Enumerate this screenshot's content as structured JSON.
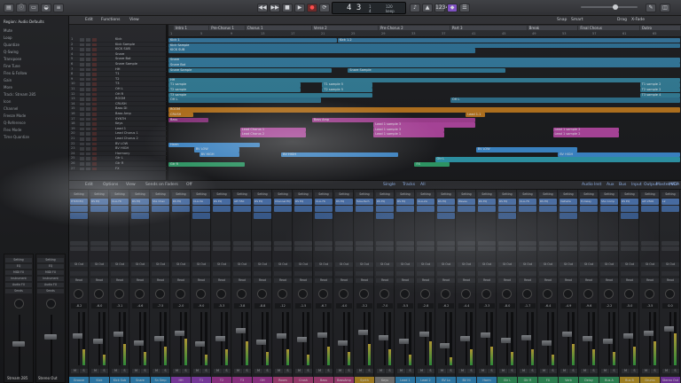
{
  "topbar": {
    "lcd_bar": "4 3",
    "lcd_beat": [
      "1",
      "4"
    ],
    "lcd_tempo": [
      "120",
      "keep"
    ],
    "buttons": [
      "stop",
      "rewind",
      "forward",
      "play",
      "record",
      "cycle"
    ]
  },
  "inspector": {
    "region_header": "Region: Audio Defaults",
    "track_header": "Track: Stream 285",
    "lines": [
      "Mute",
      "Loop",
      "Quantize",
      "Q-Swing",
      "Transpose",
      "Fine Tune",
      "Flex & Follow",
      "Gain",
      "More",
      "Track: Stream 285",
      "Icon",
      "Channel",
      "Freeze Mode",
      "Q-Reference",
      "Flex Mode",
      "Time Quantize"
    ],
    "strip_labels": [
      "Stream 285",
      "Stereo Out"
    ],
    "strip_buttons": [
      "Setting",
      "EQ",
      "MIDI FX",
      "Instrument",
      "Audio FX",
      "Sends"
    ]
  },
  "arrange_menu": [
    "Edit",
    "Functions",
    "View"
  ],
  "arrange_right": [
    "Snap",
    "Smart",
    "Drag",
    "X-Fade"
  ],
  "ruler": {
    "markers": [
      "Intro 1",
      "Pre-Chorus 1",
      "Chorus 1",
      "Verse 2",
      "Pre-Chorus 2",
      "Part 3",
      "Break",
      "Final Chorus",
      "Outro"
    ],
    "numbers": [
      "1",
      "5",
      "9",
      "13",
      "17",
      "21",
      "25",
      "29",
      "33",
      "37",
      "41",
      "45",
      "49",
      "53",
      "57",
      "61",
      "65"
    ]
  },
  "tracks": [
    {
      "n": "1",
      "name": "Kick"
    },
    {
      "n": "2",
      "name": "Kick Sample"
    },
    {
      "n": "3",
      "name": "KICK SUB"
    },
    {
      "n": "4",
      "name": "Snare"
    },
    {
      "n": "5",
      "name": "Snare Bot"
    },
    {
      "n": "6",
      "name": "Snare Sample"
    },
    {
      "n": "7",
      "name": "HH"
    },
    {
      "n": "8",
      "name": "T1"
    },
    {
      "n": "9",
      "name": "T2"
    },
    {
      "n": "10",
      "name": "T3"
    },
    {
      "n": "11",
      "name": "OH L"
    },
    {
      "n": "12",
      "name": "OH R"
    },
    {
      "n": "13",
      "name": "ROOM"
    },
    {
      "n": "14",
      "name": "CRUSH"
    },
    {
      "n": "15",
      "name": "Bass DI"
    },
    {
      "n": "16",
      "name": "Bass Amp"
    },
    {
      "n": "17",
      "name": "SYNTH"
    },
    {
      "n": "18",
      "name": "Keys"
    },
    {
      "n": "19",
      "name": "Lead 1"
    },
    {
      "n": "20",
      "name": "Lead Chorus 1"
    },
    {
      "n": "21",
      "name": "Lead Chorus 2"
    },
    {
      "n": "22",
      "name": "BV LOW"
    },
    {
      "n": "23",
      "name": "BV HIGH"
    },
    {
      "n": "24",
      "name": "Harmony"
    },
    {
      "n": "25",
      "name": "Gtr L"
    },
    {
      "n": "26",
      "name": "Gtr R"
    },
    {
      "n": "27",
      "name": "FX"
    }
  ],
  "regions": [
    {
      "row": 0,
      "s": 0.0,
      "e": 0.33,
      "c": "#2f6f96",
      "t": "Kick 1"
    },
    {
      "row": 0,
      "s": 0.33,
      "e": 1.0,
      "c": "#2f6f96",
      "t": "Kick 1.2"
    },
    {
      "row": 1,
      "s": 0.0,
      "e": 1.0,
      "c": "#2a6b8f",
      "t": "Kick Sample"
    },
    {
      "row": 2,
      "s": 0.0,
      "e": 0.6,
      "c": "#2a6b8f",
      "t": "KICK SUB"
    },
    {
      "row": 4,
      "s": 0.0,
      "e": 1.0,
      "c": "#2f7497",
      "t": "Snare"
    },
    {
      "row": 5,
      "s": 0.0,
      "e": 1.0,
      "c": "#2f7497",
      "t": "Snare Bot"
    },
    {
      "row": 6,
      "s": 0.0,
      "e": 0.32,
      "c": "#2c7492",
      "t": "Snare Sample"
    },
    {
      "row": 6,
      "s": 0.35,
      "e": 0.66,
      "c": "#2c7492",
      "t": "Snare Sample"
    },
    {
      "row": 8,
      "s": 0.0,
      "e": 1.0,
      "c": "#2f7a94",
      "t": "HH"
    },
    {
      "row": 9,
      "s": 0.0,
      "e": 0.26,
      "c": "#2f7a94",
      "t": "T1 sample"
    },
    {
      "row": 9,
      "s": 0.3,
      "e": 0.4,
      "c": "#2f7a94",
      "t": "T1 sample 5"
    },
    {
      "row": 9,
      "s": 0.92,
      "e": 1.0,
      "c": "#2f7a94",
      "t": "T1 sample 2"
    },
    {
      "row": 10,
      "s": 0.0,
      "e": 0.26,
      "c": "#2f7a94",
      "t": "T2 sample"
    },
    {
      "row": 10,
      "s": 0.3,
      "e": 0.4,
      "c": "#2f7a94",
      "t": "T2 sample 5"
    },
    {
      "row": 10,
      "s": 0.92,
      "e": 1.0,
      "c": "#2f7a94",
      "t": "T2 sample 2"
    },
    {
      "row": 11,
      "s": 0.0,
      "e": 0.4,
      "c": "#2f7a94",
      "t": "T3 sample"
    },
    {
      "row": 11,
      "s": 0.92,
      "e": 1.0,
      "c": "#2f7a94",
      "t": "T3 sample 4"
    },
    {
      "row": 12,
      "s": 0.0,
      "e": 0.3,
      "c": "#2b6e8a",
      "t": "OH L"
    },
    {
      "row": 12,
      "s": 0.55,
      "e": 1.0,
      "c": "#2b6e8a",
      "t": "OH L"
    },
    {
      "row": 14,
      "s": 0.0,
      "e": 1.0,
      "c": "#b8731b",
      "t": "ROOM"
    },
    {
      "row": 15,
      "s": 0.0,
      "e": 0.05,
      "c": "#b8731b",
      "t": "CRUSH"
    },
    {
      "row": 15,
      "s": 0.58,
      "e": 0.62,
      "c": "#b8731b",
      "t": "Lead 1.1"
    },
    {
      "row": 16,
      "s": 0.0,
      "e": 0.08,
      "c": "#8b2f7e",
      "t": "Bass"
    },
    {
      "row": 16,
      "s": 0.28,
      "e": 0.6,
      "c": "#a33c92",
      "t": "Bass Amp"
    },
    {
      "row": 17,
      "s": 0.4,
      "e": 0.6,
      "c": "#b144a0",
      "t": "Lead 1 sample 3"
    },
    {
      "row": 18,
      "s": 0.14,
      "e": 0.27,
      "c": "#b144a0",
      "t": "Lead Chorus 1"
    },
    {
      "row": 18,
      "s": 0.4,
      "e": 0.54,
      "c": "#b144a0",
      "t": "Lead 1 sample 3"
    },
    {
      "row": 18,
      "s": 0.75,
      "e": 0.88,
      "c": "#b144a0",
      "t": "Lead 1 sample 2"
    },
    {
      "row": 19,
      "s": 0.14,
      "e": 0.27,
      "c": "#b144a0",
      "t": "Lead Chorus 2"
    },
    {
      "row": 19,
      "s": 0.4,
      "e": 0.54,
      "c": "#b144a0",
      "t": "Lead 1 sample 1"
    },
    {
      "row": 19,
      "s": 0.75,
      "e": 0.88,
      "c": "#b144a0",
      "t": "Lead 1 sample 2"
    },
    {
      "row": 21,
      "s": 0.0,
      "e": 0.18,
      "c": "#3b8bd2",
      "t": "Harm"
    },
    {
      "row": 22,
      "s": 0.05,
      "e": 0.14,
      "c": "#3b8bd2",
      "t": "BV LOW"
    },
    {
      "row": 22,
      "s": 0.6,
      "e": 0.8,
      "c": "#3b8bd2",
      "t": "BV LOW"
    },
    {
      "row": 23,
      "s": 0.06,
      "e": 0.14,
      "c": "#3b8bd2",
      "t": "BV HIGH"
    },
    {
      "row": 23,
      "s": 0.22,
      "e": 0.45,
      "c": "#3b8bd2",
      "t": "BV HIGH"
    },
    {
      "row": 23,
      "s": 0.76,
      "e": 1.0,
      "c": "#3b8bd2",
      "t": "BV HIGH"
    },
    {
      "row": 24,
      "s": 0.52,
      "e": 1.0,
      "c": "#2d9cb0",
      "t": "Gtr L"
    },
    {
      "row": 25,
      "s": 0.0,
      "e": 0.15,
      "c": "#2ea36b",
      "t": "Gtr R"
    },
    {
      "row": 25,
      "s": 0.48,
      "e": 0.55,
      "c": "#2ea36b",
      "t": "FX"
    }
  ],
  "mixer": {
    "menu": [
      "Edit",
      "Options",
      "View",
      "Sends on Faders",
      "Off"
    ],
    "tabs": [
      "Single",
      "Tracks",
      "All"
    ],
    "filters": [
      "Audio",
      "Inst",
      "Aux",
      "Bus",
      "Input",
      "Output",
      "Master/VCA",
      "MIDI"
    ],
    "strips": [
      {
        "name": "Groove",
        "color": "#3a9bd6",
        "plugin": "HTCM EQ",
        "vol": "-8.2"
      },
      {
        "name": "Kick",
        "color": "#3a9bd6",
        "plugin": "RS EQ",
        "vol": "-6.0"
      },
      {
        "name": "Kick Sub",
        "color": "#3a9bd6",
        "plugin": "CLA-76",
        "vol": "-3.1"
      },
      {
        "name": "Snare",
        "color": "#3a9bd6",
        "plugin": "RS EQ",
        "vol": "-4.6"
      },
      {
        "name": "Sn Smp",
        "color": "#3a9bd6",
        "plugin": "SSL Chan",
        "vol": "-7.5"
      },
      {
        "name": "HH",
        "color": "#9a49c9",
        "plugin": "RS EQ",
        "vol": "-2.0"
      },
      {
        "name": "T1",
        "color": "#9a49c9",
        "plugin": "CLA-3A",
        "vol": "-9.0"
      },
      {
        "name": "T2",
        "color": "#b23fa6",
        "plugin": "RS EQ",
        "vol": "-5.3"
      },
      {
        "name": "T3",
        "color": "#b23fa6",
        "plugin": "API 550",
        "vol": "-3.8"
      },
      {
        "name": "OH",
        "color": "#b23fa6",
        "plugin": "RS EQ",
        "vol": "-8.8"
      },
      {
        "name": "Room",
        "color": "#c24a8a",
        "plugin": "Channel EQ",
        "vol": "-12"
      },
      {
        "name": "Crush",
        "color": "#c24a8a",
        "plugin": "RS EQ",
        "vol": "-1.5"
      },
      {
        "name": "Bass",
        "color": "#c24a8a",
        "plugin": "CLA-76",
        "vol": "-6.7"
      },
      {
        "name": "BassAmp",
        "color": "#c24a8a",
        "plugin": "RS EQ",
        "vol": "-4.0"
      },
      {
        "name": "Synth",
        "color": "#d2a32e",
        "plugin": "Tube-Tech",
        "vol": "-3.2"
      },
      {
        "name": "Keys",
        "color": "#8f8f8f",
        "plugin": "RS EQ",
        "vol": "-7.0"
      },
      {
        "name": "Lead 1",
        "color": "#3a9bd6",
        "plugin": "RS EQ",
        "vol": "-5.5"
      },
      {
        "name": "Lead 2",
        "color": "#3a9bd6",
        "plugin": "CLA-2A",
        "vol": "-2.8"
      },
      {
        "name": "BV Lo",
        "color": "#3a9bd6",
        "plugin": "RS EQ",
        "vol": "-6.2"
      },
      {
        "name": "BV Hi",
        "color": "#3a9bd6",
        "plugin": "Waves",
        "vol": "-4.4"
      },
      {
        "name": "Harm",
        "color": "#3a9bd6",
        "plugin": "RS EQ",
        "vol": "-3.3"
      },
      {
        "name": "Gtr L",
        "color": "#3aa86a",
        "plugin": "RS EQ",
        "vol": "-8.0"
      },
      {
        "name": "Gtr R",
        "color": "#3aa86a",
        "plugin": "CLA-76",
        "vol": "-1.7"
      },
      {
        "name": "FX",
        "color": "#3aa86a",
        "plugin": "RS EQ",
        "vol": "-6.4"
      },
      {
        "name": "Verb",
        "color": "#3aa86a",
        "plugin": "Valhalla",
        "vol": "-4.9"
      },
      {
        "name": "Delay",
        "color": "#3aa86a",
        "plugin": "H-Delay",
        "vol": "-9.6"
      },
      {
        "name": "Bus A",
        "color": "#3aa86a",
        "plugin": "SSL Comp",
        "vol": "-2.2"
      },
      {
        "name": "Bus B",
        "color": "#d1a92f",
        "plugin": "RS EQ",
        "vol": "-5.0"
      },
      {
        "name": "Drums",
        "color": "#d1a92f",
        "plugin": "API 2500",
        "vol": "-3.5"
      },
      {
        "name": "Stereo Out",
        "color": "#8d3fbf",
        "plugin": "L2",
        "vol": "0.0"
      }
    ],
    "fader_levels": [
      0.55,
      0.45,
      0.6,
      0.4,
      0.5,
      0.62,
      0.38,
      0.5,
      0.66,
      0.42,
      0.55,
      0.48,
      0.57,
      0.4,
      0.63,
      0.52,
      0.45,
      0.6,
      0.35,
      0.5,
      0.58,
      0.47,
      0.52,
      0.41,
      0.6,
      0.5,
      0.44,
      0.55,
      0.62,
      0.7
    ],
    "meter_levels": [
      0.3,
      0.2,
      0.4,
      0.25,
      0.35,
      0.5,
      0.2,
      0.3,
      0.45,
      0.25,
      0.3,
      0.2,
      0.35,
      0.25,
      0.4,
      0.3,
      0.2,
      0.45,
      0.15,
      0.3,
      0.35,
      0.25,
      0.3,
      0.2,
      0.4,
      0.3,
      0.25,
      0.35,
      0.45,
      0.6
    ]
  }
}
